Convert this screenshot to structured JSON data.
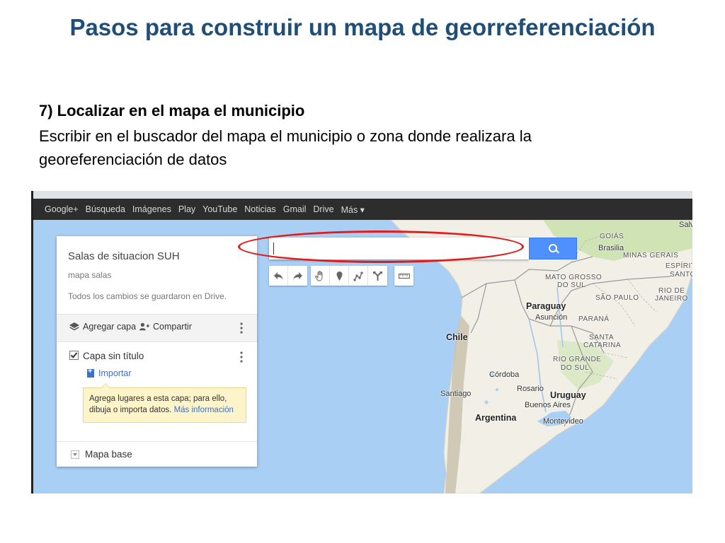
{
  "slide": {
    "title": "Pasos para construir un mapa de georreferenciación",
    "step_heading": "7) Localizar en el mapa el municipio",
    "step_body": "Escribir en el buscador del mapa el municipio o zona donde realizara la georeferenciación de datos"
  },
  "google_bar": {
    "items": [
      "Google+",
      "Búsqueda",
      "Imágenes",
      "Play",
      "YouTube",
      "Noticias",
      "Gmail",
      "Drive",
      "Más ▾"
    ]
  },
  "panel": {
    "map_title": "Salas de situacion SUH",
    "map_description": "mapa salas",
    "save_status": "Todos los cambios se guardaron en Drive.",
    "add_layer_label": "Agregar capa",
    "share_label": "Compartir",
    "layer_name": "Capa sin título",
    "import_label": "Importar",
    "tip_text": "Agrega lugares a esta capa; para ello, dibuja o importa datos.",
    "tip_link": "Más información",
    "base_map_label": "Mapa base"
  },
  "search": {
    "value": "",
    "placeholder": ""
  },
  "map_labels": {
    "goias": "GOIÁS",
    "brasilia": "Brasilia",
    "minas_gerais": "MINAS GERAIS",
    "espirito_santo_1": "ESPÍRIT",
    "espirito_santo_2": "SANTO",
    "mato_grosso_1": "MATO GROSSO",
    "mato_grosso_2": "DO SUL",
    "rio_de_janeiro_1": "RIO DE",
    "rio_de_janeiro_2": "JANEIRO",
    "sao_paulo": "SÃO PAULO",
    "salvador": "Salv",
    "paraguay": "Paraguay",
    "asuncion": "Asunción",
    "parana": "PARANÁ",
    "santa_catarina_1": "SANTA",
    "santa_catarina_2": "CATARINA",
    "chile": "Chile",
    "rio_grande_1": "RIO GRANDE",
    "rio_grande_2": "DO SUL",
    "cordoba": "Córdoba",
    "santiago": "Santiago",
    "rosario": "Rosario",
    "uruguay": "Uruguay",
    "buenos_aires": "Buenos Aires",
    "argentina": "Argentina",
    "montevideo": "Montevideo"
  },
  "colors": {
    "title": "#1f4e79",
    "ocean": "#a9cff5",
    "land": "#f1efe6",
    "forest": "#cfe3b4",
    "mountains": "#c9c2ad",
    "search_button": "#4d90fe",
    "highlight": "#e21b1b",
    "google_bar": "#2d2d2d"
  }
}
